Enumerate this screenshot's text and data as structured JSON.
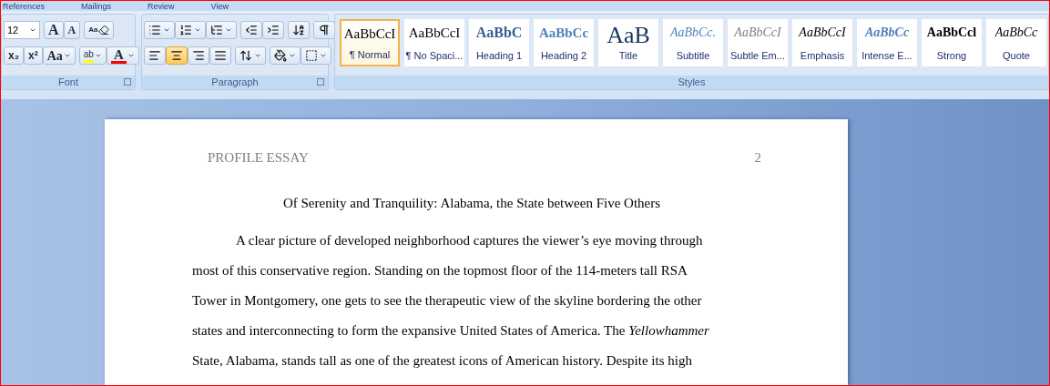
{
  "menu_tabs": [
    {
      "label": "References"
    },
    {
      "label": "Mailings"
    },
    {
      "label": "Review"
    },
    {
      "label": "View"
    }
  ],
  "font_group": {
    "label": "Font",
    "size_field": {
      "value": "12"
    },
    "row1": [
      {
        "kind": "grow",
        "glyph": "A"
      },
      {
        "kind": "shrink",
        "glyph": "A"
      },
      {
        "kind": "clear",
        "glyph": "Aa"
      }
    ],
    "row2": [
      {
        "kind": "subscript",
        "glyph": "x₂"
      },
      {
        "kind": "superscript",
        "glyph": "x²"
      },
      {
        "kind": "case",
        "glyph": "Aa"
      },
      {
        "kind": "highlight",
        "glyph": "ab"
      },
      {
        "kind": "color",
        "glyph": "A"
      }
    ]
  },
  "paragraph_group": {
    "label": "Paragraph",
    "row1": [
      {
        "kind": "bullets"
      },
      {
        "kind": "numbering"
      },
      {
        "kind": "multilevel"
      },
      {
        "kind": "outdent"
      },
      {
        "kind": "indent"
      },
      {
        "kind": "sort"
      },
      {
        "kind": "marks"
      }
    ],
    "align": [
      {
        "kind": "left",
        "selected": false
      },
      {
        "kind": "center",
        "selected": true
      },
      {
        "kind": "right",
        "selected": false
      },
      {
        "kind": "justify",
        "selected": false
      }
    ],
    "row2": [
      {
        "kind": "spacing"
      },
      {
        "kind": "shading"
      },
      {
        "kind": "borders"
      }
    ]
  },
  "styles_group": {
    "label": "Styles",
    "items": [
      {
        "kind": "normal",
        "preview": "AaBbCcI",
        "label": "¶ Normal",
        "selected": true
      },
      {
        "kind": "normal",
        "preview": "AaBbCcI",
        "label": "¶ No Spaci...",
        "selected": false
      },
      {
        "kind": "heading1",
        "preview": "AaBbC",
        "label": "Heading 1",
        "selected": false
      },
      {
        "kind": "heading2",
        "preview": "AaBbCc",
        "label": "Heading 2",
        "selected": false
      },
      {
        "kind": "title",
        "preview": "AaB",
        "label": "Title",
        "selected": false
      },
      {
        "kind": "subtitle",
        "preview": "AaBbCc.",
        "label": "Subtitle",
        "selected": false
      },
      {
        "kind": "subtle",
        "preview": "AaBbCcI",
        "label": "Subtle Em...",
        "selected": false
      },
      {
        "kind": "emphasis",
        "preview": "AaBbCcI",
        "label": "Emphasis",
        "selected": false
      },
      {
        "kind": "intense",
        "preview": "AaBbCc",
        "label": "Intense E...",
        "selected": false
      },
      {
        "kind": "strong",
        "preview": "AaBbCcl",
        "label": "Strong",
        "selected": false
      },
      {
        "kind": "quote",
        "preview": "AaBbCc",
        "label": "Quote",
        "selected": false
      }
    ]
  },
  "document": {
    "header": "PROFILE ESSAY",
    "page_number": "2",
    "title": "Of Serenity and Tranquility: Alabama, the State between Five Others",
    "lines": [
      "A clear picture of developed neighborhood captures the viewer’s eye moving through",
      "most of this conservative region. Standing on the topmost floor of the 114-meters tall RSA",
      "Tower in Montgomery, one gets to see the therapeutic view of the skyline bordering the other",
      "states and interconnecting to form the expansive United States of America. The *Yellowhammer*",
      "State, Alabama, stands tall as one of the greatest icons of American history. Despite its high"
    ]
  }
}
